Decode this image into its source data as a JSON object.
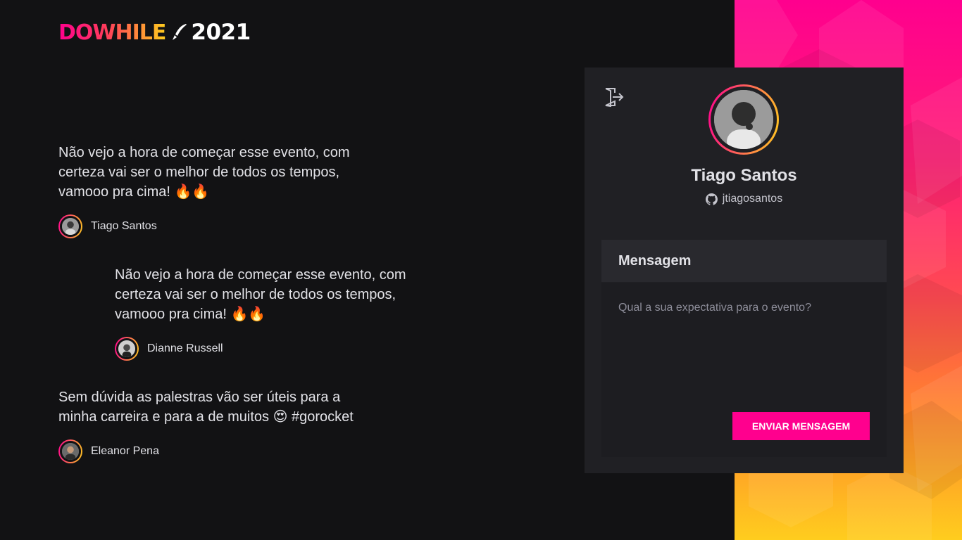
{
  "header": {
    "logo_word": "DOWHILE",
    "logo_year": "2021"
  },
  "messages": [
    {
      "text": "Não vejo a hora de começar esse evento, com certeza vai ser o melhor de todos os tempos, vamooo pra cima! 🔥🔥",
      "user": "Tiago Santos"
    },
    {
      "text": "Não vejo a hora de começar esse evento, com certeza vai ser o melhor de todos os tempos, vamooo pra cima! 🔥🔥",
      "user": "Dianne Russell"
    },
    {
      "text": "Sem dúvida as palestras vão ser úteis para a minha carreira e para a de muitos 😍 #gorocket",
      "user": "Eleanor Pena"
    }
  ],
  "profile": {
    "name": "Tiago Santos",
    "login": "jtiagosantos"
  },
  "form": {
    "title": "Mensagem",
    "placeholder": "Qual a sua expectativa para o evento?",
    "value": "",
    "submit_label": "Enviar mensagem"
  },
  "colors": {
    "background": "#121214",
    "card": "#202024",
    "accent_pink": "#ff008e",
    "accent_yellow": "#ffcd1e"
  },
  "icons": {
    "logout": "sign-out-icon",
    "github": "github-icon",
    "logo": "rocket-icon"
  }
}
